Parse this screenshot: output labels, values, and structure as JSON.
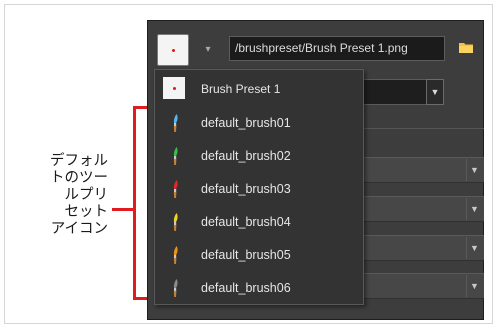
{
  "toolbar": {
    "path_value": "/brushpreset/Brush Preset 1.png",
    "dropdown_arrow_glyph": "▾"
  },
  "menu": {
    "items": [
      {
        "label": "Brush Preset 1",
        "icon": "red-dot-swatch-icon"
      },
      {
        "label": "default_brush01",
        "icon": "brush-icon",
        "color": "#5ab4ea"
      },
      {
        "label": "default_brush02",
        "icon": "brush-icon",
        "color": "#3cbd4a"
      },
      {
        "label": "default_brush03",
        "icon": "brush-icon",
        "color": "#e02a2a"
      },
      {
        "label": "default_brush04",
        "icon": "brush-icon",
        "color": "#f2d22a"
      },
      {
        "label": "default_brush05",
        "icon": "brush-icon",
        "color": "#e8941c"
      },
      {
        "label": "default_brush06",
        "icon": "brush-icon",
        "color": "#8a8a8a"
      }
    ]
  },
  "annotation": {
    "lines": [
      "デフォル",
      "トのツー",
      "ルプリ",
      "セット",
      "アイコン"
    ],
    "color": "#e01b22"
  },
  "colors": {
    "panel": "#3d3d3d",
    "menu": "#333333",
    "field": "#1b1b1b"
  }
}
